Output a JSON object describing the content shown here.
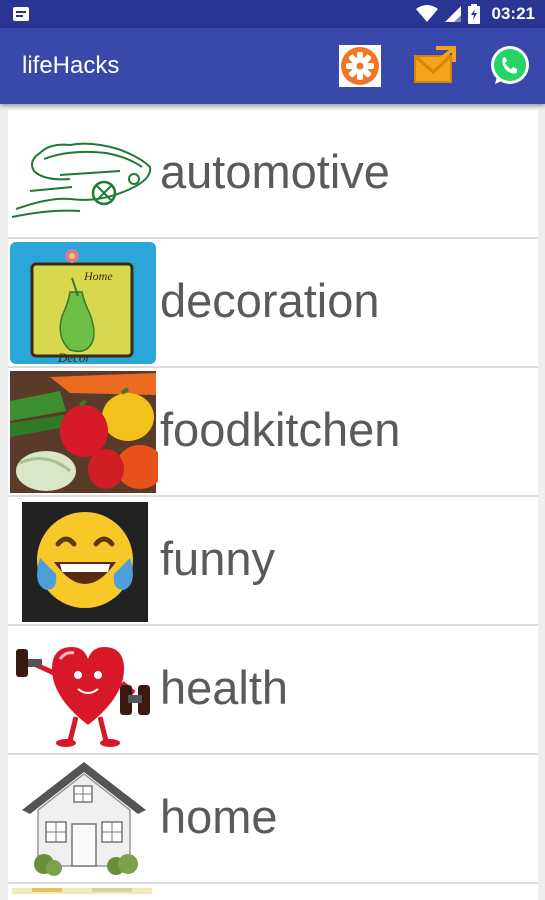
{
  "status_bar": {
    "time": "03:21",
    "icons": [
      "notification-icon",
      "wifi-icon",
      "signal-icon",
      "battery-icon"
    ]
  },
  "app_bar": {
    "title": "lifeHacks",
    "actions": [
      "settings-icon",
      "share-email-icon",
      "whatsapp-icon"
    ]
  },
  "categories": [
    {
      "label": "automotive",
      "icon": "car-sketch"
    },
    {
      "label": "decoration",
      "icon": "home-decor-vase"
    },
    {
      "label": "foodkitchen",
      "icon": "vegetables"
    },
    {
      "label": "funny",
      "icon": "laughing-emoji"
    },
    {
      "label": "health",
      "icon": "heart-dumbbell"
    },
    {
      "label": "home",
      "icon": "house"
    }
  ],
  "colors": {
    "status_bar": "#283593",
    "app_bar": "#3949ab",
    "label_text": "#5a5a5a",
    "divider": "#dcdcdc"
  }
}
